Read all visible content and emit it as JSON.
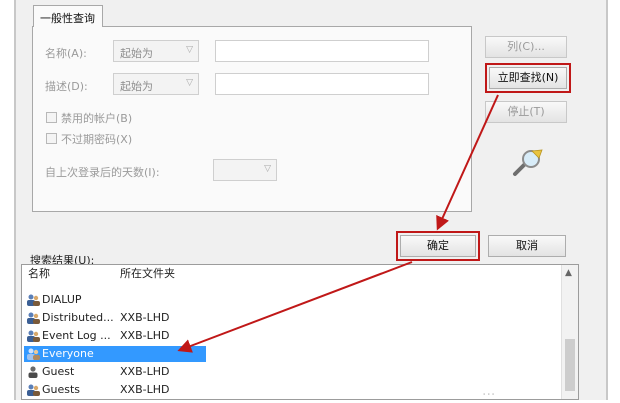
{
  "tabs": [
    {
      "label": "一般性查询"
    }
  ],
  "query": {
    "name_label": "名称(A):",
    "name_mode": "起始为",
    "name_value": "",
    "desc_label": "描述(D):",
    "desc_mode": "起始为",
    "desc_value": "",
    "disabled_accounts": "禁用的帐户(B)",
    "no_expire_pwd": "不过期密码(X)",
    "days_since_logon_label": "自上次登录后的天数(I):",
    "days_since_logon_value": ""
  },
  "buttons": {
    "columns": "列(C)...",
    "find_now": "立即查找(N)",
    "stop": "停止(T)",
    "ok": "确定",
    "cancel": "取消"
  },
  "results": {
    "label": "搜索结果(U):",
    "columns": [
      "名称",
      "所在文件夹"
    ],
    "rows": [
      {
        "name": "DIALUP",
        "folder": ""
      },
      {
        "name": "Distributed...",
        "folder": "XXB-LHD"
      },
      {
        "name": "Event Log ...",
        "folder": "XXB-LHD"
      },
      {
        "name": "Everyone",
        "folder": "",
        "selected": true
      },
      {
        "name": "Guest",
        "folder": "XXB-LHD"
      },
      {
        "name": "Guests",
        "folder": "XXB-LHD"
      }
    ]
  },
  "colors": {
    "highlight": "#c01818",
    "selection": "#3399ff"
  },
  "icons": {
    "search": "magnifier-icon",
    "user": "user-group-icon"
  }
}
